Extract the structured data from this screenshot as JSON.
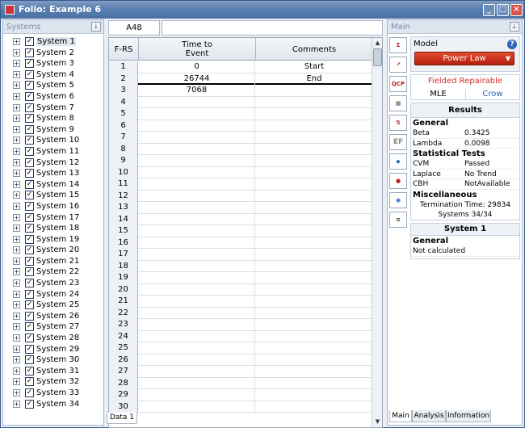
{
  "window": {
    "title": "Folio: Example 6"
  },
  "systems_panel": {
    "header": "Systems",
    "items": [
      "System 1",
      "System 2",
      "System 3",
      "System 4",
      "System 5",
      "System 6",
      "System 7",
      "System 8",
      "System 9",
      "System 10",
      "System 11",
      "System 12",
      "System 13",
      "System 14",
      "System 15",
      "System 16",
      "System 17",
      "System 18",
      "System 19",
      "System 20",
      "System 21",
      "System 22",
      "System 23",
      "System 24",
      "System 25",
      "System 26",
      "System 27",
      "System 28",
      "System 29",
      "System 30",
      "System 31",
      "System 32",
      "System 33",
      "System 34"
    ]
  },
  "grid": {
    "cell_ref": "A48",
    "headers": {
      "row": "F-RS",
      "col1": "Time to\nEvent",
      "col2": "Comments"
    },
    "rows": [
      {
        "n": "1",
        "c1": "0",
        "c2": "Start"
      },
      {
        "n": "2",
        "c1": "26744",
        "c2": "End"
      },
      {
        "n": "3",
        "c1": "7068",
        "c2": ""
      },
      {
        "n": "4",
        "c1": "",
        "c2": ""
      },
      {
        "n": "5",
        "c1": "",
        "c2": ""
      },
      {
        "n": "6",
        "c1": "",
        "c2": ""
      },
      {
        "n": "7",
        "c1": "",
        "c2": ""
      },
      {
        "n": "8",
        "c1": "",
        "c2": ""
      },
      {
        "n": "9",
        "c1": "",
        "c2": ""
      },
      {
        "n": "10",
        "c1": "",
        "c2": ""
      },
      {
        "n": "11",
        "c1": "",
        "c2": ""
      },
      {
        "n": "12",
        "c1": "",
        "c2": ""
      },
      {
        "n": "13",
        "c1": "",
        "c2": ""
      },
      {
        "n": "14",
        "c1": "",
        "c2": ""
      },
      {
        "n": "15",
        "c1": "",
        "c2": ""
      },
      {
        "n": "16",
        "c1": "",
        "c2": ""
      },
      {
        "n": "17",
        "c1": "",
        "c2": ""
      },
      {
        "n": "18",
        "c1": "",
        "c2": ""
      },
      {
        "n": "19",
        "c1": "",
        "c2": ""
      },
      {
        "n": "20",
        "c1": "",
        "c2": ""
      },
      {
        "n": "21",
        "c1": "",
        "c2": ""
      },
      {
        "n": "22",
        "c1": "",
        "c2": ""
      },
      {
        "n": "23",
        "c1": "",
        "c2": ""
      },
      {
        "n": "24",
        "c1": "",
        "c2": ""
      },
      {
        "n": "25",
        "c1": "",
        "c2": ""
      },
      {
        "n": "26",
        "c1": "",
        "c2": ""
      },
      {
        "n": "27",
        "c1": "",
        "c2": ""
      },
      {
        "n": "28",
        "c1": "",
        "c2": ""
      },
      {
        "n": "29",
        "c1": "",
        "c2": ""
      },
      {
        "n": "30",
        "c1": "",
        "c2": ""
      }
    ],
    "sheet_tab": "Data 1"
  },
  "main_panel": {
    "header": "Main",
    "model_label": "Model",
    "model_value": "Power Law",
    "data_type": "Fielded Repairable",
    "method_options": [
      "MLE",
      "Crow"
    ],
    "results": {
      "title": "Results",
      "general_label": "General",
      "general": [
        {
          "k": "Beta",
          "v": "0.3425"
        },
        {
          "k": "Lambda",
          "v": "0.0098"
        }
      ],
      "tests_label": "Statistical Tests",
      "tests": [
        {
          "k": "CVM",
          "v": "Passed"
        },
        {
          "k": "Laplace",
          "v": "No Trend"
        },
        {
          "k": "CBH",
          "v": "NotAvailable"
        }
      ],
      "misc_label": "Miscellaneous",
      "termination": "Termination Time: 29834",
      "systems_count": "Systems 34/34"
    },
    "system1": {
      "title": "System 1",
      "general_label": "General",
      "status": "Not calculated"
    },
    "tabs": [
      "Main",
      "Analysis",
      "Information"
    ]
  },
  "toolbar": {
    "icons": [
      "calculate-icon",
      "plot-icon",
      "qcp-icon",
      "report-icon",
      "transfer-icon",
      "ef-icon",
      "diamond-icon",
      "alert-icon",
      "globe-icon",
      "settings-icon"
    ]
  }
}
